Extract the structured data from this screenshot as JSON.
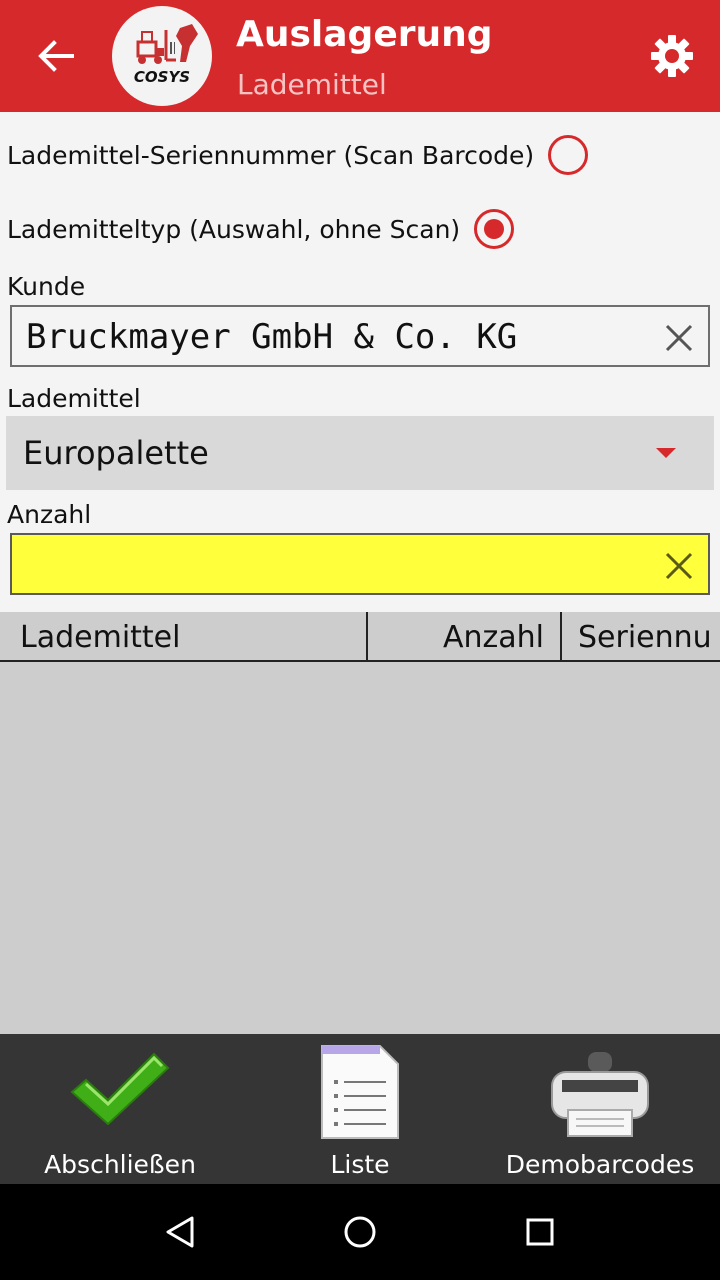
{
  "header": {
    "title": "Auslagerung",
    "subtitle": "Lademittel",
    "logo_text": "COSYS",
    "accent_color": "#d6292b"
  },
  "options": {
    "serial_label": "Lademittel-Seriennummer (Scan Barcode)",
    "serial_selected": false,
    "type_label": "Lademitteltyp (Auswahl, ohne Scan)",
    "type_selected": true
  },
  "form": {
    "kunde_label": "Kunde",
    "kunde_value": "Bruckmayer GmbH & Co. KG",
    "lademittel_label": "Lademittel",
    "lademittel_value": "Europalette",
    "anzahl_label": "Anzahl",
    "anzahl_value": ""
  },
  "table": {
    "columns": [
      "Lademittel",
      "Anzahl",
      "Seriennu"
    ],
    "rows": []
  },
  "bottom_actions": {
    "finish_label": "Abschließen",
    "list_label": "Liste",
    "demo_label": "Demobarcodes"
  },
  "icons": {
    "back": "arrow-left-icon",
    "settings": "gear-icon",
    "clear": "close-icon",
    "finish": "checkmark-icon",
    "list": "document-list-icon",
    "demo": "printer-icon",
    "nav_back": "triangle-back-icon",
    "nav_home": "circle-home-icon",
    "nav_recent": "square-recent-icon"
  }
}
